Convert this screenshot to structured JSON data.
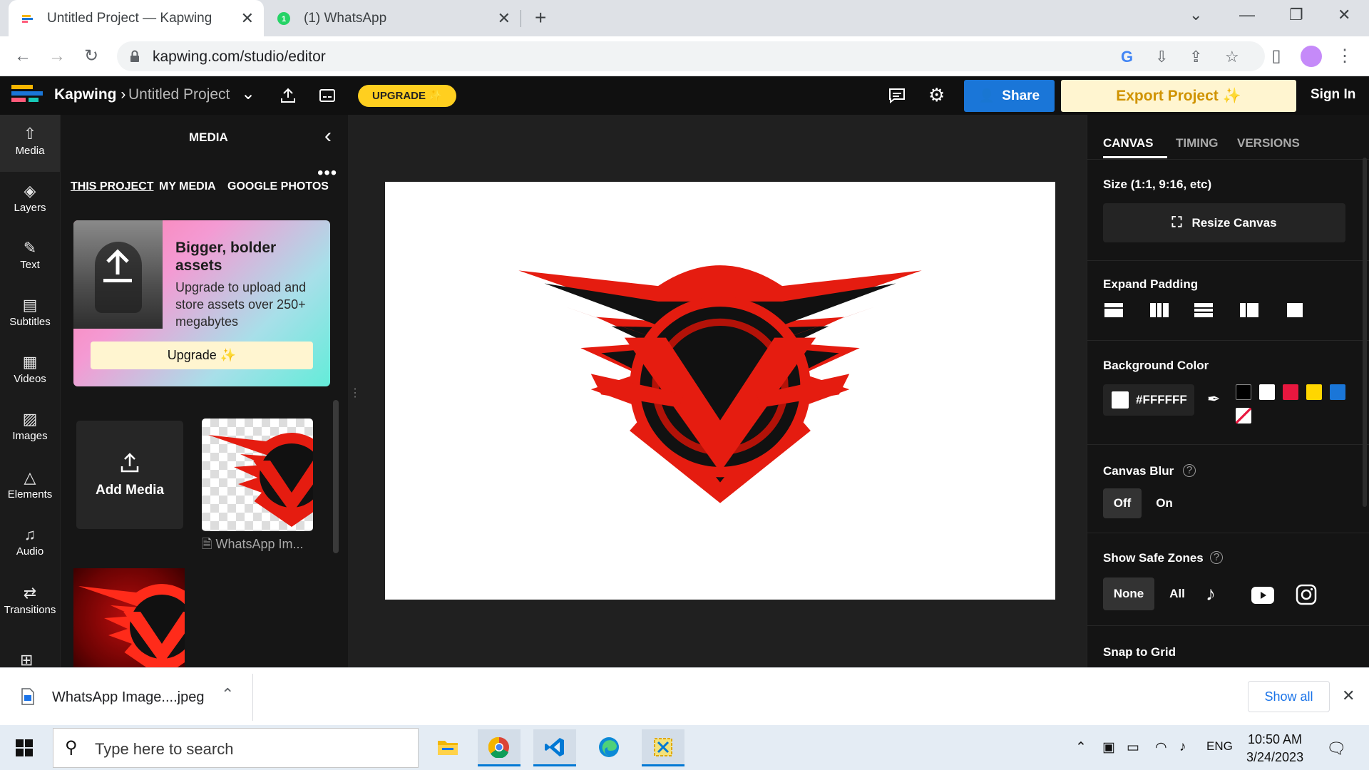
{
  "browser": {
    "tabs": [
      {
        "title": "Untitled Project — Kapwing",
        "active": true
      },
      {
        "title": "(1) WhatsApp",
        "active": false,
        "badge": "1"
      }
    ],
    "url": "kapwing.com/studio/editor"
  },
  "kapwing": {
    "brand": "Kapwing",
    "breadcrumb_sep": "›",
    "project_name": "Untitled Project",
    "upgrade_label": "UPGRADE ✨",
    "share_label": "Share",
    "export_label": "Export Project ✨",
    "signin_label": "Sign In",
    "accent": "#1a76d8"
  },
  "rail": {
    "items": [
      {
        "label": "Media",
        "icon": "upload-cloud-icon",
        "active": true
      },
      {
        "label": "Layers",
        "icon": "layers-icon"
      },
      {
        "label": "Text",
        "icon": "text-edit-icon"
      },
      {
        "label": "Subtitles",
        "icon": "subtitles-icon"
      },
      {
        "label": "Videos",
        "icon": "film-icon"
      },
      {
        "label": "Images",
        "icon": "image-icon"
      },
      {
        "label": "Elements",
        "icon": "shapes-icon"
      },
      {
        "label": "Audio",
        "icon": "music-note-icon"
      },
      {
        "label": "Transitions",
        "icon": "transitions-icon"
      }
    ]
  },
  "media": {
    "title": "MEDIA",
    "tabs": [
      "THIS PROJECT",
      "MY MEDIA",
      "GOOGLE PHOTOS"
    ],
    "upsell": {
      "heading": "Bigger, bolder assets",
      "body": "Upgrade to upload and store assets over 250+ megabytes",
      "button": "Upgrade ✨"
    },
    "add_media": "Add Media",
    "items": [
      {
        "caption": "WhatsApp Im..."
      }
    ]
  },
  "props": {
    "tabs": [
      "CANVAS",
      "TIMING",
      "VERSIONS"
    ],
    "size_label": "Size (1:1, 9:16, etc)",
    "resize_button": "Resize Canvas",
    "expand_padding": "Expand Padding",
    "background_color": "Background Color",
    "bg_hex": "#FFFFFF",
    "swatches": [
      "#000000",
      "#ffffff",
      "#e8173f",
      "#ffd600",
      "#1a76d8"
    ],
    "canvas_blur": "Canvas Blur",
    "blur_options": [
      "Off",
      "On"
    ],
    "safe_zones": "Show Safe Zones",
    "safe_options": [
      "None",
      "All"
    ],
    "snap_to_grid": "Snap to Grid"
  },
  "downloads": {
    "file_name": "WhatsApp Image....jpeg",
    "show_all": "Show all"
  },
  "taskbar": {
    "search_placeholder": "Type here to search",
    "lang": "ENG",
    "time": "10:50 AM",
    "date": "3/24/2023"
  }
}
